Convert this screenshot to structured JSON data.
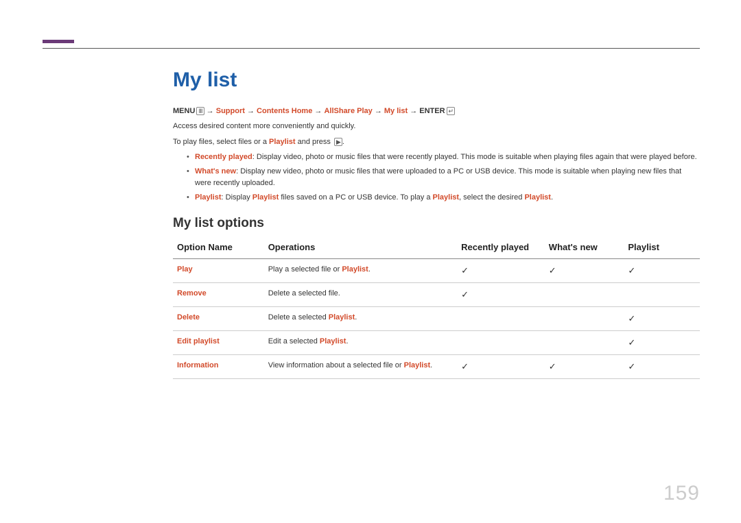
{
  "title": "My list",
  "breadcrumb": {
    "menu": "MENU",
    "support": "Support",
    "contents_home": "Contents Home",
    "allshare_play": "AllShare Play",
    "my_list": "My list",
    "enter": "ENTER",
    "arrow": "→"
  },
  "intro_line1": "Access desired content more conveniently and quickly.",
  "intro_line2_a": "To play files, select files or a ",
  "intro_line2_hl": "Playlist",
  "intro_line2_b": " and press ",
  "bullets": [
    {
      "hl": "Recently played",
      "text": ": Display video, photo or music files that were recently played. This mode is suitable when playing files again that were played before."
    },
    {
      "hl": "What's new",
      "text": ": Display new video, photo or music files that were uploaded to a PC or USB device. This mode is suitable when playing new files that were recently uploaded."
    },
    {
      "hl1": "Playlist",
      "t1": ": Display ",
      "hl2": "Playlist",
      "t2": " files saved on a PC or USB device. To play a ",
      "hl3": "Playlist",
      "t3": ", select the desired ",
      "hl4": "Playlist",
      "t4": "."
    }
  ],
  "subtitle": "My list options",
  "table": {
    "headers": {
      "name": "Option Name",
      "ops": "Operations",
      "rp": "Recently played",
      "wn": "What's new",
      "pl": "Playlist"
    },
    "rows": [
      {
        "name": "Play",
        "op_a": "Play a selected file or ",
        "op_hl": "Playlist",
        "op_b": ".",
        "rp": "✓",
        "wn": "✓",
        "pl": "✓"
      },
      {
        "name": "Remove",
        "op_a": "Delete a selected file.",
        "op_hl": "",
        "op_b": "",
        "rp": "✓",
        "wn": "",
        "pl": ""
      },
      {
        "name": "Delete",
        "op_a": "Delete a selected ",
        "op_hl": "Playlist",
        "op_b": ".",
        "rp": "",
        "wn": "",
        "pl": "✓"
      },
      {
        "name": "Edit playlist",
        "op_a": "Edit a selected ",
        "op_hl": "Playlist",
        "op_b": ".",
        "rp": "",
        "wn": "",
        "pl": "✓"
      },
      {
        "name": "Information",
        "op_a": "View information about a selected file or ",
        "op_hl": "Playlist",
        "op_b": ".",
        "rp": "✓",
        "wn": "✓",
        "pl": "✓"
      }
    ]
  },
  "icons": {
    "menu": "Ⅲ",
    "enter": "↵",
    "play": "▶"
  },
  "pagenum": "159"
}
